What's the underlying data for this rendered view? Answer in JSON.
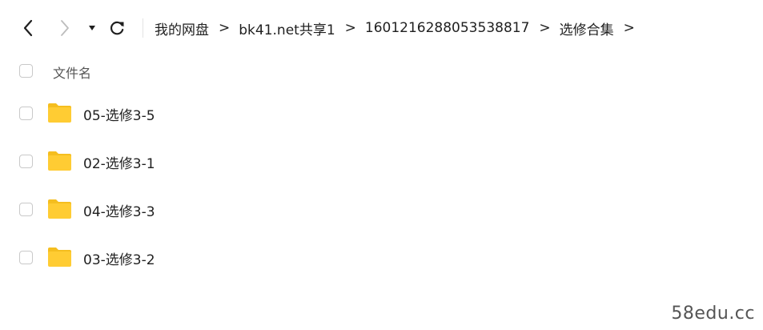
{
  "toolbar": {
    "back_icon": "chevron-left-icon",
    "forward_icon": "chevron-right-icon",
    "dropdown_icon": "caret-down-icon",
    "refresh_icon": "refresh-icon"
  },
  "breadcrumb": {
    "items": [
      {
        "label": "我的网盘"
      },
      {
        "label": "bk41.net共享1"
      },
      {
        "label": "1601216288053538817"
      },
      {
        "label": "选修合集"
      }
    ],
    "separator": ">"
  },
  "list": {
    "column_name": "文件名",
    "rows": [
      {
        "name": "05-选修3-5",
        "type": "folder"
      },
      {
        "name": "02-选修3-1",
        "type": "folder"
      },
      {
        "name": "04-选修3-3",
        "type": "folder"
      },
      {
        "name": "03-选修3-2",
        "type": "folder"
      }
    ]
  },
  "colors": {
    "folder": "#FFCC33",
    "folder_tab": "#F5BE1F",
    "text": "#1f1f1f",
    "checkbox_border": "#c9c9c9"
  },
  "watermark": "58edu.cc"
}
